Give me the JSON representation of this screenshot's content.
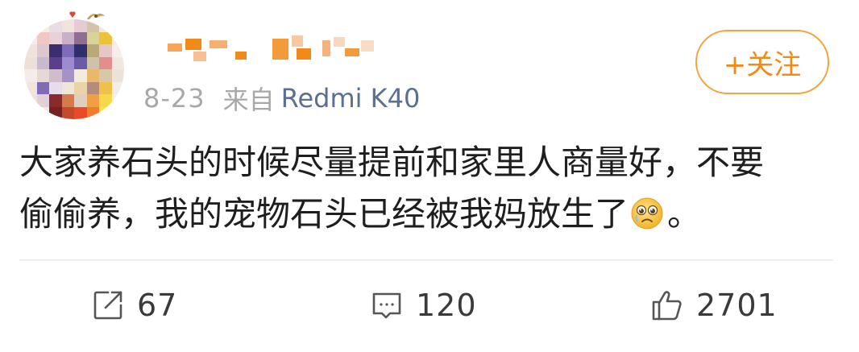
{
  "post": {
    "date": "8-23",
    "source_prefix": "来自",
    "device": "Redmi K40",
    "follow_label": "+关注",
    "content_lines": [
      "大家养石头的时候尽量提前和家里人商量好，不要",
      "偷偷养，我的宠物石头已经被我妈放生了"
    ],
    "content_tail": "。",
    "emoji_icon": "crying-face-emoji-icon",
    "stats": {
      "reposts": "67",
      "comments": "120",
      "likes": "2701"
    }
  },
  "colors": {
    "follow_accent": "#f28a1a",
    "device_link": "#5a6f92",
    "meta_gray": "#a8a8a8"
  },
  "icons": {
    "repost": "share-icon",
    "comment": "comment-icon",
    "like": "thumbs-up-icon"
  }
}
